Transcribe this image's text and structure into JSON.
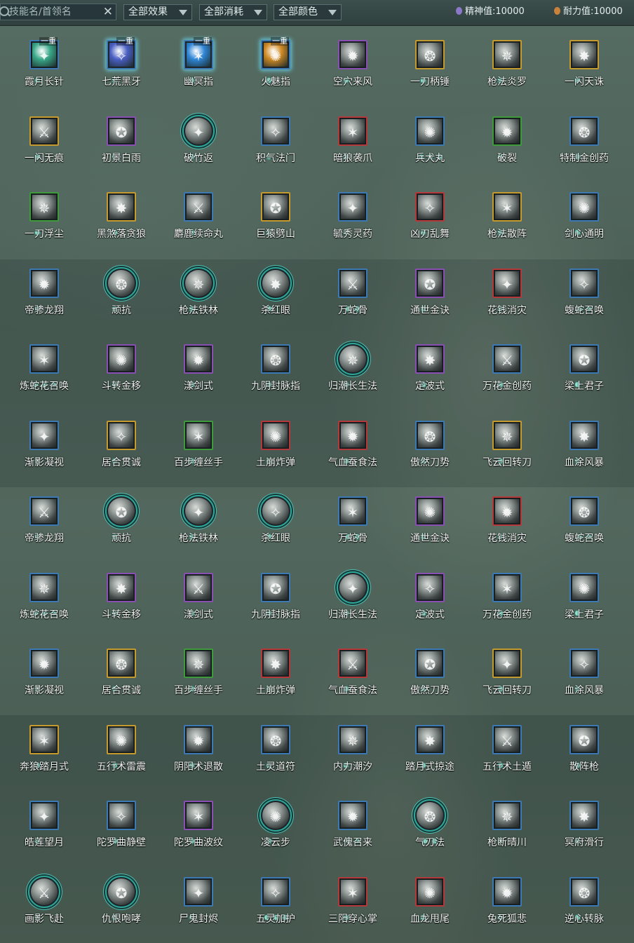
{
  "toolbar": {
    "search_placeholder": "技能名/首领名",
    "clear_label": "✕",
    "filters": [
      {
        "label": "全部效果"
      },
      {
        "label": "全部消耗"
      },
      {
        "label": "全部颜色"
      }
    ],
    "spirit_label": "精神值:",
    "spirit_value": "10000",
    "endurance_label": "耐力值:",
    "endurance_value": "10000"
  },
  "colors": {
    "blue": "#3d7ab4",
    "gold": "#c59a2e",
    "purple": "#8a4fb3",
    "red": "#b5393a",
    "green": "#3f9a3c",
    "round": "#2ea69a"
  },
  "skills": [
    {
      "name": "霞月长针",
      "frame": "sq",
      "color": "#3d7ab4",
      "tint": "#3aa889",
      "dots": 1,
      "badge": "一重",
      "glow": false,
      "icon": "needle-icon"
    },
    {
      "name": "七荒黑牙",
      "frame": "sq",
      "color": "#3d7ab4",
      "tint": "#4a5fc4",
      "dots": 1,
      "badge": "一重",
      "glow": true,
      "icon": "fang-icon"
    },
    {
      "name": "幽冥指",
      "frame": "sq",
      "color": "#3d7ab4",
      "tint": "#2f86d6",
      "dots": 1,
      "badge": "一重",
      "glow": true,
      "icon": "finger-icon"
    },
    {
      "name": "火魅指",
      "frame": "sq",
      "color": "#3d7ab4",
      "tint": "#d08a24",
      "dots": 1,
      "badge": "一重",
      "glow": true,
      "icon": "fire-finger-icon"
    },
    {
      "name": "空穴来风",
      "frame": "sq",
      "color": "#8a4fb3",
      "tint": "",
      "dots": 1,
      "badge": "",
      "glow": false,
      "icon": "wind-icon"
    },
    {
      "name": "一刀柄锤",
      "frame": "sq",
      "color": "#c59a2e",
      "tint": "",
      "dots": 1,
      "badge": "",
      "glow": false,
      "icon": "hammer-icon"
    },
    {
      "name": "枪法炎罗",
      "frame": "sq",
      "color": "#c59a2e",
      "tint": "",
      "dots": 1,
      "badge": "",
      "glow": false,
      "icon": "spear-icon"
    },
    {
      "name": "一闪天诛",
      "frame": "sq",
      "color": "#c59a2e",
      "tint": "",
      "dots": 1,
      "badge": "",
      "glow": false,
      "icon": "slash-icon"
    },
    {
      "name": "一闪无痕",
      "frame": "sq",
      "color": "#c59a2e",
      "tint": "",
      "dots": 1,
      "badge": "",
      "glow": false,
      "icon": "slash-icon"
    },
    {
      "name": "初景白雨",
      "frame": "sq",
      "color": "#8a4fb3",
      "tint": "",
      "dots": 1,
      "badge": "",
      "glow": false,
      "icon": "rain-icon"
    },
    {
      "name": "破竹返",
      "frame": "round",
      "color": "#2ea69a",
      "tint": "",
      "dots": 1,
      "badge": "",
      "glow": false,
      "icon": "bamboo-icon"
    },
    {
      "name": "积气法门",
      "frame": "sq",
      "color": "#3d7ab4",
      "tint": "",
      "dots": 1,
      "badge": "",
      "glow": false,
      "icon": "energy-icon"
    },
    {
      "name": "暗狼袭爪",
      "frame": "sq",
      "color": "#b5393a",
      "tint": "",
      "dots": 1,
      "badge": "",
      "glow": false,
      "icon": "claw-icon"
    },
    {
      "name": "兵犬丸",
      "frame": "sq",
      "color": "#3d7ab4",
      "tint": "",
      "dots": 3,
      "badge": "",
      "glow": false,
      "icon": "dog-icon"
    },
    {
      "name": "破裂",
      "frame": "sq",
      "color": "#3f9a3c",
      "tint": "",
      "dots": 1,
      "badge": "",
      "glow": false,
      "icon": "shatter-icon"
    },
    {
      "name": "特制金创药",
      "frame": "sq",
      "color": "#3d7ab4",
      "tint": "",
      "dots": 1,
      "badge": "",
      "glow": false,
      "icon": "potion-icon"
    },
    {
      "name": "一刀浮尘",
      "frame": "sq",
      "color": "#3f9a3c",
      "tint": "",
      "dots": 1,
      "badge": "",
      "glow": false,
      "icon": "blade-icon"
    },
    {
      "name": "黑煞落贪狼",
      "frame": "sq",
      "color": "#c59a2e",
      "tint": "",
      "dots": 1,
      "badge": "",
      "glow": false,
      "icon": "wolf-icon"
    },
    {
      "name": "麝鹿续命丸",
      "frame": "sq",
      "color": "#3d7ab4",
      "tint": "",
      "dots": 1,
      "badge": "",
      "glow": false,
      "icon": "pill-icon"
    },
    {
      "name": "巨猿劈山",
      "frame": "sq",
      "color": "#c59a2e",
      "tint": "",
      "dots": 1,
      "badge": "",
      "glow": false,
      "icon": "ape-icon"
    },
    {
      "name": "毓秀灵药",
      "frame": "sq",
      "color": "#3d7ab4",
      "tint": "",
      "dots": 1,
      "badge": "",
      "glow": false,
      "icon": "gourd-icon"
    },
    {
      "name": "凶刃乱舞",
      "frame": "sq",
      "color": "#b5393a",
      "tint": "",
      "dots": 1,
      "badge": "",
      "glow": false,
      "icon": "blades-icon"
    },
    {
      "name": "枪法散阵",
      "frame": "sq",
      "color": "#c59a2e",
      "tint": "",
      "dots": 1,
      "badge": "",
      "glow": false,
      "icon": "spear-icon"
    },
    {
      "name": "剑心通明",
      "frame": "sq",
      "color": "#3d7ab4",
      "tint": "",
      "dots": 1,
      "badge": "",
      "glow": false,
      "icon": "sword-icon"
    },
    {
      "name": "帝骖龙翔",
      "frame": "sq",
      "color": "#3d7ab4",
      "tint": "",
      "dots": 1,
      "badge": "",
      "glow": false,
      "icon": "dragon-icon"
    },
    {
      "name": "顽抗",
      "frame": "round",
      "color": "#2ea69a",
      "tint": "",
      "dots": 1,
      "badge": "",
      "glow": false,
      "icon": "resist-icon"
    },
    {
      "name": "枪法铁林",
      "frame": "round",
      "color": "#2ea69a",
      "tint": "",
      "dots": 1,
      "badge": "",
      "glow": false,
      "icon": "spear-ring-icon"
    },
    {
      "name": "杀红眼",
      "frame": "round",
      "color": "#2ea69a",
      "tint": "",
      "dots": 1,
      "badge": "",
      "glow": false,
      "icon": "helmet-icon"
    },
    {
      "name": "万蛇骨",
      "frame": "sq",
      "color": "#3d7ab4",
      "tint": "",
      "dots": 2,
      "badge": "",
      "glow": false,
      "icon": "snake-icon"
    },
    {
      "name": "通世金诀",
      "frame": "sq",
      "color": "#8a4fb3",
      "tint": "",
      "dots": 1,
      "badge": "",
      "glow": false,
      "icon": "dice-icon"
    },
    {
      "name": "花钱消灾",
      "frame": "sq",
      "color": "#b5393a",
      "tint": "",
      "dots": 1,
      "badge": "",
      "glow": false,
      "icon": "coin-bag-icon"
    },
    {
      "name": "蝮蛇召唤",
      "frame": "sq",
      "color": "#3d7ab4",
      "tint": "",
      "dots": 2,
      "badge": "",
      "glow": false,
      "icon": "viper-icon"
    },
    {
      "name": "炼蛇花召唤",
      "frame": "sq",
      "color": "#3d7ab4",
      "tint": "",
      "dots": 3,
      "badge": "",
      "glow": false,
      "icon": "snake-flower-icon"
    },
    {
      "name": "斗转金移",
      "frame": "sq",
      "color": "#8a4fb3",
      "tint": "",
      "dots": 1,
      "badge": "",
      "glow": false,
      "icon": "swirl-icon"
    },
    {
      "name": "漾剑式",
      "frame": "sq",
      "color": "#8a4fb3",
      "tint": "",
      "dots": 1,
      "badge": "",
      "glow": false,
      "icon": "sword-dance-icon"
    },
    {
      "name": "九阴封脉指",
      "frame": "sq",
      "color": "#3d7ab4",
      "tint": "",
      "dots": 1,
      "badge": "",
      "glow": false,
      "icon": "hand-icon"
    },
    {
      "name": "归潮长生法",
      "frame": "round",
      "color": "#2ea69a",
      "tint": "",
      "dots": 1,
      "badge": "",
      "glow": false,
      "icon": "lotus-icon"
    },
    {
      "name": "定波式",
      "frame": "sq",
      "color": "#8a4fb3",
      "tint": "",
      "dots": 1,
      "badge": "",
      "glow": false,
      "icon": "wave-icon"
    },
    {
      "name": "万花金创药",
      "frame": "sq",
      "color": "#3d7ab4",
      "tint": "",
      "dots": 1,
      "badge": "",
      "glow": false,
      "icon": "herb-icon"
    },
    {
      "name": "梁上君子",
      "frame": "sq",
      "color": "#3d7ab4",
      "tint": "",
      "dots": 1,
      "badge": "",
      "glow": false,
      "icon": "thief-icon"
    },
    {
      "name": "渐影凝视",
      "frame": "sq",
      "color": "#3d7ab4",
      "tint": "",
      "dots": 1,
      "badge": "",
      "glow": false,
      "icon": "gaze-icon"
    },
    {
      "name": "居合贯诚",
      "frame": "sq",
      "color": "#c59a2e",
      "tint": "",
      "dots": 1,
      "badge": "",
      "glow": false,
      "icon": "iai-icon"
    },
    {
      "name": "百步缠丝手",
      "frame": "sq",
      "color": "#3f9a3c",
      "tint": "",
      "dots": 1,
      "badge": "",
      "glow": false,
      "icon": "silk-icon"
    },
    {
      "name": "土崩炸弹",
      "frame": "sq",
      "color": "#b5393a",
      "tint": "",
      "dots": 1,
      "badge": "",
      "glow": false,
      "icon": "bomb-icon"
    },
    {
      "name": "气血蚕食法",
      "frame": "sq",
      "color": "#b5393a",
      "tint": "",
      "dots": 1,
      "badge": "",
      "glow": false,
      "icon": "blood-icon"
    },
    {
      "name": "傲然刀势",
      "frame": "sq",
      "color": "#3d7ab4",
      "tint": "",
      "dots": 1,
      "badge": "",
      "glow": false,
      "icon": "blade-stance-icon"
    },
    {
      "name": "飞云回转刀",
      "frame": "sq",
      "color": "#c59a2e",
      "tint": "",
      "dots": 1,
      "badge": "",
      "glow": false,
      "icon": "cloud-blade-icon"
    },
    {
      "name": "血涂风暴",
      "frame": "sq",
      "color": "#3d7ab4",
      "tint": "",
      "dots": 1,
      "badge": "",
      "glow": false,
      "icon": "storm-icon"
    },
    {
      "name": "帝骖龙翔",
      "frame": "sq",
      "color": "#3d7ab4",
      "tint": "",
      "dots": 1,
      "badge": "",
      "glow": false,
      "icon": "dragon-icon"
    },
    {
      "name": "顽抗",
      "frame": "round",
      "color": "#2ea69a",
      "tint": "",
      "dots": 1,
      "badge": "",
      "glow": false,
      "icon": "resist-icon"
    },
    {
      "name": "枪法铁林",
      "frame": "round",
      "color": "#2ea69a",
      "tint": "",
      "dots": 1,
      "badge": "",
      "glow": false,
      "icon": "spear-ring-icon"
    },
    {
      "name": "杀红眼",
      "frame": "round",
      "color": "#2ea69a",
      "tint": "",
      "dots": 1,
      "badge": "",
      "glow": false,
      "icon": "helmet-icon"
    },
    {
      "name": "万蛇骨",
      "frame": "sq",
      "color": "#3d7ab4",
      "tint": "",
      "dots": 2,
      "badge": "",
      "glow": false,
      "icon": "snake-icon"
    },
    {
      "name": "通世金诀",
      "frame": "sq",
      "color": "#8a4fb3",
      "tint": "",
      "dots": 1,
      "badge": "",
      "glow": false,
      "icon": "dice-icon"
    },
    {
      "name": "花钱消灾",
      "frame": "sq",
      "color": "#b5393a",
      "tint": "",
      "dots": 1,
      "badge": "",
      "glow": false,
      "icon": "coin-bag-icon"
    },
    {
      "name": "蝮蛇召唤",
      "frame": "sq",
      "color": "#3d7ab4",
      "tint": "",
      "dots": 2,
      "badge": "",
      "glow": false,
      "icon": "viper-icon"
    },
    {
      "name": "炼蛇花召唤",
      "frame": "sq",
      "color": "#3d7ab4",
      "tint": "",
      "dots": 3,
      "badge": "",
      "glow": false,
      "icon": "snake-flower-icon"
    },
    {
      "name": "斗转金移",
      "frame": "sq",
      "color": "#8a4fb3",
      "tint": "",
      "dots": 1,
      "badge": "",
      "glow": false,
      "icon": "swirl-icon"
    },
    {
      "name": "漾剑式",
      "frame": "sq",
      "color": "#8a4fb3",
      "tint": "",
      "dots": 1,
      "badge": "",
      "glow": false,
      "icon": "sword-dance-icon"
    },
    {
      "name": "九阴封脉指",
      "frame": "sq",
      "color": "#3d7ab4",
      "tint": "",
      "dots": 1,
      "badge": "",
      "glow": false,
      "icon": "hand-icon"
    },
    {
      "name": "归潮长生法",
      "frame": "round",
      "color": "#2ea69a",
      "tint": "",
      "dots": 1,
      "badge": "",
      "glow": false,
      "icon": "lotus-icon"
    },
    {
      "name": "定波式",
      "frame": "sq",
      "color": "#8a4fb3",
      "tint": "",
      "dots": 1,
      "badge": "",
      "glow": false,
      "icon": "wave-icon"
    },
    {
      "name": "万花金创药",
      "frame": "sq",
      "color": "#3d7ab4",
      "tint": "",
      "dots": 1,
      "badge": "",
      "glow": false,
      "icon": "herb-icon"
    },
    {
      "name": "梁上君子",
      "frame": "sq",
      "color": "#3d7ab4",
      "tint": "",
      "dots": 1,
      "badge": "",
      "glow": false,
      "icon": "thief-icon"
    },
    {
      "name": "渐影凝视",
      "frame": "sq",
      "color": "#3d7ab4",
      "tint": "",
      "dots": 1,
      "badge": "",
      "glow": false,
      "icon": "gaze-icon"
    },
    {
      "name": "居合贯诚",
      "frame": "sq",
      "color": "#c59a2e",
      "tint": "",
      "dots": 1,
      "badge": "",
      "glow": false,
      "icon": "iai-icon"
    },
    {
      "name": "百步缠丝手",
      "frame": "sq",
      "color": "#3f9a3c",
      "tint": "",
      "dots": 1,
      "badge": "",
      "glow": false,
      "icon": "silk-icon"
    },
    {
      "name": "土崩炸弹",
      "frame": "sq",
      "color": "#b5393a",
      "tint": "",
      "dots": 1,
      "badge": "",
      "glow": false,
      "icon": "bomb-icon"
    },
    {
      "name": "气血蚕食法",
      "frame": "sq",
      "color": "#b5393a",
      "tint": "",
      "dots": 1,
      "badge": "",
      "glow": false,
      "icon": "blood-icon"
    },
    {
      "name": "傲然刀势",
      "frame": "sq",
      "color": "#3d7ab4",
      "tint": "",
      "dots": 1,
      "badge": "",
      "glow": false,
      "icon": "blade-stance-icon"
    },
    {
      "name": "飞云回转刀",
      "frame": "sq",
      "color": "#c59a2e",
      "tint": "",
      "dots": 1,
      "badge": "",
      "glow": false,
      "icon": "cloud-blade-icon"
    },
    {
      "name": "血涂风暴",
      "frame": "sq",
      "color": "#3d7ab4",
      "tint": "",
      "dots": 1,
      "badge": "",
      "glow": false,
      "icon": "storm-icon"
    },
    {
      "name": "奔狼踏月式",
      "frame": "sq",
      "color": "#c59a2e",
      "tint": "",
      "dots": 1,
      "badge": "",
      "glow": false,
      "icon": "wolf-moon-icon"
    },
    {
      "name": "五行术雷震",
      "frame": "sq",
      "color": "#c59a2e",
      "tint": "",
      "dots": 1,
      "badge": "",
      "glow": false,
      "icon": "thunder-icon"
    },
    {
      "name": "阴阳术退散",
      "frame": "sq",
      "color": "#3d7ab4",
      "tint": "",
      "dots": 1,
      "badge": "",
      "glow": false,
      "icon": "yinyang-icon"
    },
    {
      "name": "土灵道符",
      "frame": "sq",
      "color": "#3d7ab4",
      "tint": "",
      "dots": 1,
      "badge": "",
      "glow": false,
      "icon": "talisman-icon"
    },
    {
      "name": "内力潮汐",
      "frame": "sq",
      "color": "#3d7ab4",
      "tint": "",
      "dots": 1,
      "badge": "",
      "glow": false,
      "icon": "tide-icon"
    },
    {
      "name": "踏月式掠途",
      "frame": "sq",
      "color": "#3d7ab4",
      "tint": "",
      "dots": 1,
      "badge": "",
      "glow": false,
      "icon": "moon-step-icon"
    },
    {
      "name": "五行术土遁",
      "frame": "sq",
      "color": "#3d7ab4",
      "tint": "",
      "dots": 1,
      "badge": "",
      "glow": false,
      "icon": "earth-icon"
    },
    {
      "name": "散阵枪",
      "frame": "sq",
      "color": "#3d7ab4",
      "tint": "",
      "dots": 1,
      "badge": "",
      "glow": false,
      "icon": "spear-icon"
    },
    {
      "name": "皓莲望月",
      "frame": "sq",
      "color": "#3d7ab4",
      "tint": "",
      "dots": 1,
      "badge": "",
      "glow": false,
      "icon": "crescent-icon"
    },
    {
      "name": "陀罗曲静壁",
      "frame": "sq",
      "color": "#3d7ab4",
      "tint": "",
      "dots": 1,
      "badge": "",
      "glow": false,
      "icon": "wall-icon"
    },
    {
      "name": "陀罗曲波纹",
      "frame": "sq",
      "color": "#8a4fb3",
      "tint": "",
      "dots": 1,
      "badge": "",
      "glow": false,
      "icon": "ripple-icon"
    },
    {
      "name": "凌云步",
      "frame": "round",
      "color": "#2ea69a",
      "tint": "",
      "dots": 1,
      "badge": "",
      "glow": false,
      "icon": "step-icon"
    },
    {
      "name": "武傀召来",
      "frame": "sq",
      "color": "#3d7ab4",
      "tint": "",
      "dots": 2,
      "badge": "",
      "glow": false,
      "icon": "puppet-icon"
    },
    {
      "name": "气刃法",
      "frame": "round",
      "color": "#2ea69a",
      "tint": "",
      "dots": 2,
      "badge": "",
      "glow": false,
      "icon": "air-blade-icon"
    },
    {
      "name": "枪断晴川",
      "frame": "sq",
      "color": "#3d7ab4",
      "tint": "",
      "dots": 1,
      "badge": "",
      "glow": false,
      "icon": "spear-icon"
    },
    {
      "name": "冥府滑行",
      "frame": "sq",
      "color": "#3d7ab4",
      "tint": "",
      "dots": 1,
      "badge": "",
      "glow": false,
      "icon": "ghost-icon"
    },
    {
      "name": "画影飞赴",
      "frame": "round",
      "color": "#2ea69a",
      "tint": "",
      "dots": 1,
      "badge": "",
      "glow": false,
      "icon": "shadow-icon"
    },
    {
      "name": "仇恨咆哮",
      "frame": "round",
      "color": "#2ea69a",
      "tint": "",
      "dots": 1,
      "badge": "",
      "glow": false,
      "icon": "roar-icon"
    },
    {
      "name": "尸鬼封烬",
      "frame": "sq",
      "color": "#3d7ab4",
      "tint": "",
      "dots": 1,
      "badge": "",
      "glow": false,
      "icon": "seal-icon"
    },
    {
      "name": "五灵加护",
      "frame": "sq",
      "color": "#3d7ab4",
      "tint": "",
      "dots": 3,
      "badge": "",
      "glow": false,
      "icon": "guard-icon"
    },
    {
      "name": "三阳穿心掌",
      "frame": "sq",
      "color": "#b5393a",
      "tint": "",
      "dots": 1,
      "badge": "",
      "glow": false,
      "icon": "palm-icon"
    },
    {
      "name": "血龙甩尾",
      "frame": "sq",
      "color": "#b5393a",
      "tint": "",
      "dots": 1,
      "badge": "",
      "glow": false,
      "icon": "dragon-tail-icon"
    },
    {
      "name": "兔死狐悲",
      "frame": "sq",
      "color": "#3d7ab4",
      "tint": "",
      "dots": 1,
      "badge": "",
      "glow": false,
      "icon": "fox-icon"
    },
    {
      "name": "逆心转脉",
      "frame": "sq",
      "color": "#3d7ab4",
      "tint": "",
      "dots": 1,
      "badge": "",
      "glow": false,
      "icon": "reverse-icon"
    }
  ]
}
